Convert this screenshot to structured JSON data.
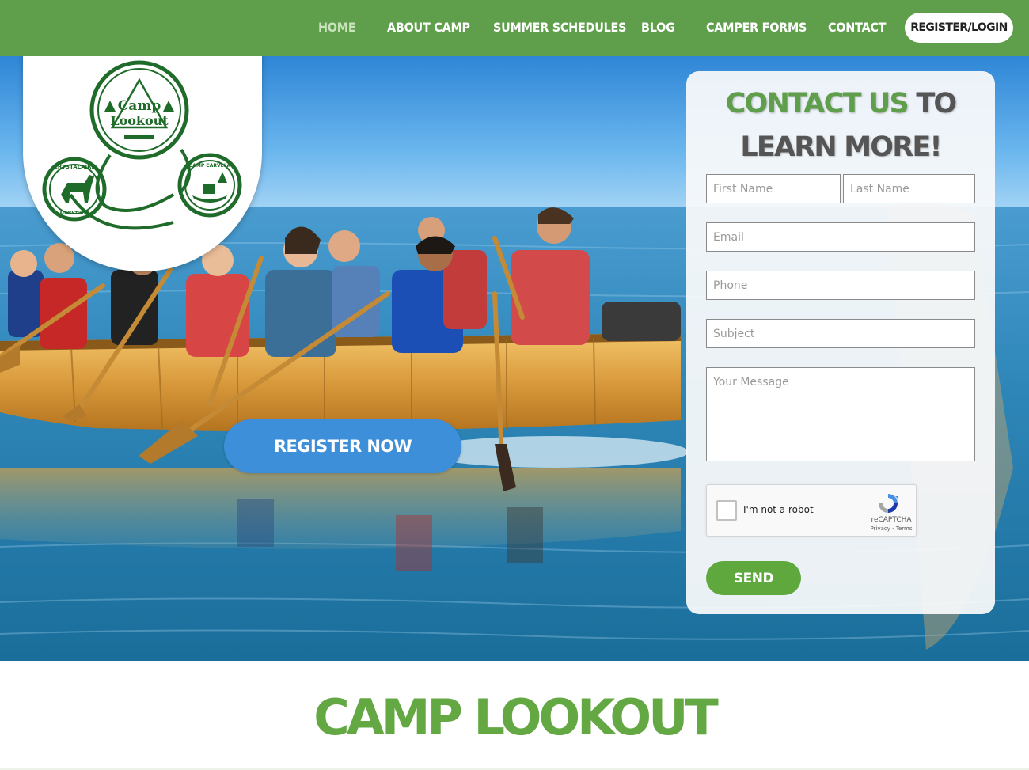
{
  "colors": {
    "nav_bg": "#5f9e4b",
    "accent_green": "#5fa83d",
    "title_green": "#64a844",
    "register_blue": "#3d8fd9",
    "logo_green": "#1f6b2a"
  },
  "logo": {
    "main_text_line1": "Camp",
    "main_text_line2": "Lookout",
    "left_badge_text": "CRYSTALAIRE",
    "left_badge_sub": "ADVENTURES",
    "right_badge_text": "CAMP CARVELA"
  },
  "nav": {
    "items": [
      {
        "label": "HOME",
        "active": true
      },
      {
        "label": "ABOUT CAMP"
      },
      {
        "label": "SUMMER SCHEDULES"
      },
      {
        "label": "BLOG"
      },
      {
        "label": "CAMPER FORMS"
      },
      {
        "label": "CONTACT"
      }
    ],
    "register_login": "REGISTER/LOGIN"
  },
  "hero": {
    "register_button": "REGISTER NOW"
  },
  "contact_form": {
    "heading_green": "CONTACT US",
    "heading_rest": " TO LEARN MORE!",
    "first_name_placeholder": "First Name",
    "last_name_placeholder": "Last Name",
    "email_placeholder": "Email",
    "phone_placeholder": "Phone",
    "subject_placeholder": "Subject",
    "message_placeholder": "Your Message",
    "recaptcha_label": "I'm not a robot",
    "recaptcha_brand": "reCAPTCHA",
    "recaptcha_terms": "Privacy - Terms",
    "send_label": "SEND"
  },
  "main": {
    "title": "CAMP LOOKOUT"
  }
}
